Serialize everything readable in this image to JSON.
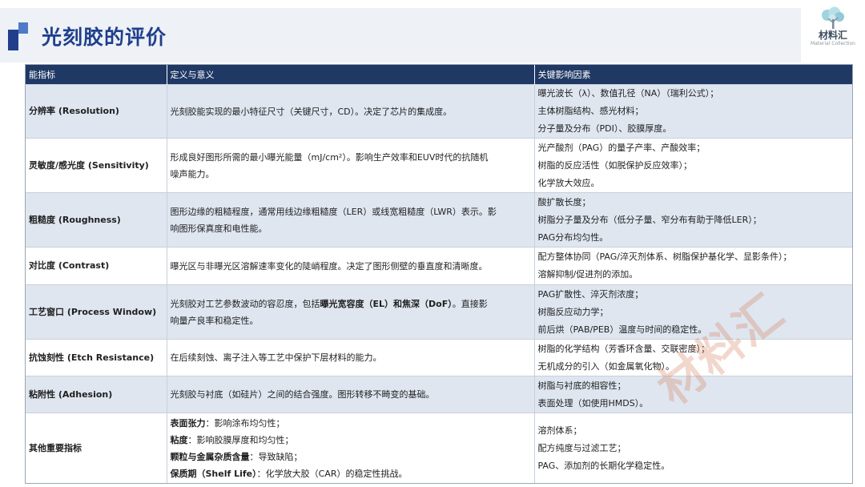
{
  "header": {
    "title": "光刻胶的评价"
  },
  "logo": {
    "name": "材料汇",
    "sub": "Material Collection"
  },
  "table": {
    "headers": [
      "能指标",
      "定义与意义",
      "关键影响因素"
    ],
    "rows": [
      {
        "metric": "分辨率 (Resolution)",
        "definition": [
          "光刻胶能实现的最小特征尺寸（关键尺寸，CD）。决定了芯片的集成度。"
        ],
        "factors": [
          "曝光波长（λ）、数值孔径（NA）（瑞利公式）；",
          "主体树脂结构、感光材料；",
          "分子量及分布（PDI）、胶膜厚度。"
        ]
      },
      {
        "metric": "灵敏度/感光度 (Sensitivity)",
        "definition": [
          "形成良好图形所需的最小曝光能量（mJ/cm²）。影响生产效率和EUV时代的抗随机",
          "噪声能力。"
        ],
        "factors": [
          "光产酸剂（PAG）的量子产率、产酸效率；",
          "树脂的反应活性（如脱保护反应效率）；",
          "化学放大效应。"
        ]
      },
      {
        "metric": "粗糙度 (Roughness)",
        "definition": [
          "图形边缘的粗糙程度，通常用线边缘粗糙度（LER）或线宽粗糙度（LWR）表示。影",
          "响图形保真度和电性能。"
        ],
        "factors": [
          "酸扩散长度；",
          "树脂分子量及分布（低分子量、窄分布有助于降低LER）；",
          "PAG分布均匀性。"
        ]
      },
      {
        "metric": "对比度 (Contrast)",
        "definition": [
          "曝光区与非曝光区溶解速率变化的陡峭程度。决定了图形侧壁的垂直度和清晰度。"
        ],
        "factors": [
          "配方整体协同（PAG/淬灭剂体系、树脂保护基化学、显影条件）；",
          "溶解抑制/促进剂的添加。"
        ]
      },
      {
        "metric": "工艺窗口 (Process Window)",
        "definition_pre": "光刻胶对工艺参数波动的容忍度，包括",
        "definition_bold": "曝光宽容度（EL）和焦深（DoF）",
        "definition_post": "。直接影",
        "definition_line2": "响量产良率和稳定性。",
        "factors": [
          "PAG扩散性、淬灭剂浓度；",
          "树脂反应动力学；",
          "前后烘（PAB/PEB）温度与时间的稳定性。"
        ]
      },
      {
        "metric": "抗蚀刻性 (Etch Resistance)",
        "definition": [
          "在后续刻蚀、离子注入等工艺中保护下层材料的能力。"
        ],
        "factors": [
          "树脂的化学结构（芳香环含量、交联密度）；",
          "无机成分的引入（如金属氧化物）。"
        ]
      },
      {
        "metric": "粘附性 (Adhesion)",
        "definition": [
          "光刻胶与衬底（如硅片）之间的结合强度。图形转移不畸变的基础。"
        ],
        "factors": [
          "树脂与衬底的相容性；",
          "表面处理（如使用HMDS）。"
        ]
      },
      {
        "metric": "其他重要指标",
        "definition_items": [
          {
            "term": "表面张力",
            "text": "：影响涂布均匀性；"
          },
          {
            "term": "粘度",
            "text": "：影响胶膜厚度和均匀性；"
          },
          {
            "term": "颗粒与金属杂质含量",
            "text": "：导致缺陷；"
          },
          {
            "term": "保质期（Shelf Life）",
            "text": "：化学放大胶（CAR）的稳定性挑战。"
          }
        ],
        "factors": [
          "溶剂体系；",
          "配方纯度与过滤工艺；",
          "PAG、添加剂的长期化学稳定性。"
        ]
      }
    ]
  },
  "watermark": {
    "text": "材料汇"
  },
  "colors": {
    "header_bg": "#1f3864",
    "title": "#1f3f8c",
    "row_alt": "#dfe6f0"
  }
}
